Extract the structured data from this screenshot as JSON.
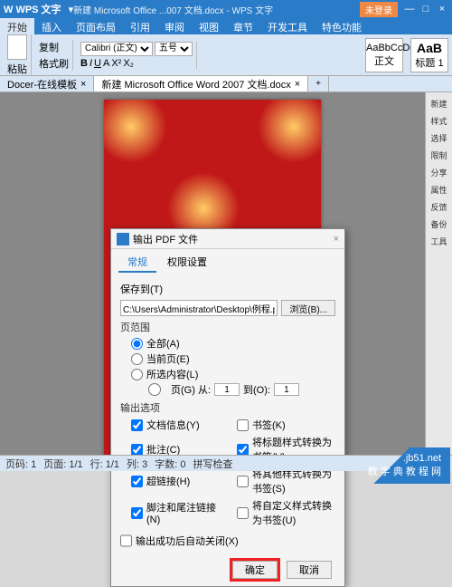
{
  "titlebar": {
    "app": "W WPS 文字",
    "doc": "新建 Microsoft Office ...007 文档.docx - WPS 文字",
    "nolog": "未登录",
    "min": "—",
    "max": "□",
    "close": "×"
  },
  "menu": {
    "tabs": [
      "开始",
      "插入",
      "页面布局",
      "引用",
      "审阅",
      "视图",
      "章节",
      "开发工具",
      "特色功能"
    ]
  },
  "ribbon": {
    "paste": "粘贴",
    "copy": "复制",
    "painter": "格式刷",
    "font": "Calibri (正文)",
    "size": "五号",
    "style_preview": "AaBbCcDd",
    "style_name": "正文",
    "style_preview2": "AaB",
    "style_name2": "标题 1"
  },
  "doctabs": {
    "tab1": "Docer-在线模板",
    "tab2": "新建 Microsoft Office Word 2007 文档.docx",
    "close": "×",
    "add": "+"
  },
  "sidebar": {
    "items": [
      "新建",
      "样式",
      "选择",
      "限制",
      "分享",
      "属性",
      "反馈",
      "备份",
      "工具"
    ]
  },
  "dialog": {
    "title": "输出 PDF 文件",
    "tabs": {
      "t1": "常规",
      "t2": "权限设置"
    },
    "save_label": "保存到(T)",
    "save_path": "C:\\Users\\Administrator\\Desktop\\例程.pdf",
    "browse": "浏览(B)...",
    "range_title": "页范围",
    "range": {
      "all": "全部(A)",
      "current": "当前页(E)",
      "selected": "所选内容(L)",
      "pages": "页(G) 从:",
      "from": "1",
      "to_label": "到(O):",
      "to": "1"
    },
    "out_title": "输出选项",
    "out": {
      "docinfo": "文档信息(Y)",
      "bookmark": "书签(K)",
      "comment": "批注(C)",
      "title2bm": "将标题样式转换为书签(V)",
      "hyperlink": "超链接(H)",
      "other2bm": "将其他样式转换为书签(S)",
      "footnote": "脚注和尾注链接(N)",
      "custom2bm": "将自定义样式转换为书签(U)"
    },
    "autoclose": "输出成功后自动关闭(X)",
    "ok": "确定",
    "cancel": "取消"
  },
  "status": {
    "page": "页码: 1",
    "pagecnt": "页面: 1/1",
    "line": "行: 1/1",
    "col": "列: 3",
    "chars": "字数: 0",
    "spell": "拼写检查"
  },
  "watermark": {
    "l1": ".jb51.net",
    "l2": "教 字 典 教 程 网"
  }
}
